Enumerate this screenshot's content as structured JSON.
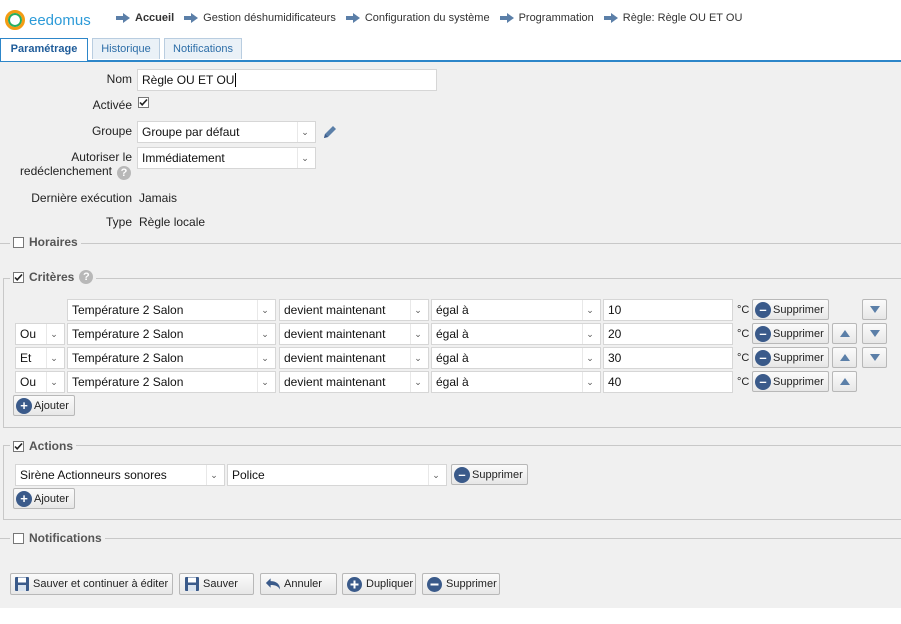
{
  "app": {
    "logo_text": "eedomus"
  },
  "breadcrumbs": [
    "Accueil",
    "Gestion déshumidificateurs",
    "Configuration du système",
    "Programmation",
    "Règle: Règle OU ET OU"
  ],
  "tabs": [
    "Paramétrage",
    "Historique",
    "Notifications"
  ],
  "form": {
    "nom_label": "Nom",
    "nom_value": "Règle OU ET OU",
    "activee_label": "Activée",
    "groupe_label": "Groupe",
    "groupe_value": "Groupe par défaut",
    "autoriser_label_1": "Autoriser le",
    "autoriser_label_2": "redéclenchement",
    "autoriser_value": "Immédiatement",
    "derniere_label": "Dernière exécution",
    "derniere_value": "Jamais",
    "type_label": "Type",
    "type_value": "Règle locale"
  },
  "sections": {
    "horaires": "Horaires",
    "criteres": "Critères",
    "actions": "Actions",
    "notifications": "Notifications"
  },
  "criteria": [
    {
      "connector": "",
      "device": "Température 2 Salon",
      "condition": "devient maintenant",
      "operator": "égal à",
      "value": "10",
      "unit": "°C"
    },
    {
      "connector": "Ou",
      "device": "Température 2 Salon",
      "condition": "devient maintenant",
      "operator": "égal à",
      "value": "20",
      "unit": "°C"
    },
    {
      "connector": "Et",
      "device": "Température 2 Salon",
      "condition": "devient maintenant",
      "operator": "égal à",
      "value": "30",
      "unit": "°C"
    },
    {
      "connector": "Ou",
      "device": "Température 2 Salon",
      "condition": "devient maintenant",
      "operator": "égal à",
      "value": "40",
      "unit": "°C"
    }
  ],
  "labels": {
    "supprimer": "Supprimer",
    "ajouter": "Ajouter"
  },
  "actions": {
    "device": "Sirène Actionneurs sonores",
    "value": "Police"
  },
  "bottom_buttons": {
    "save_continue": "Sauver et continuer à éditer",
    "save": "Sauver",
    "cancel": "Annuler",
    "duplicate": "Dupliquer",
    "delete": "Supprimer"
  },
  "colors": {
    "accent": "#2d86c9",
    "icon_blue": "#3a5a8a",
    "arrow_blue": "#5b7fa8"
  }
}
